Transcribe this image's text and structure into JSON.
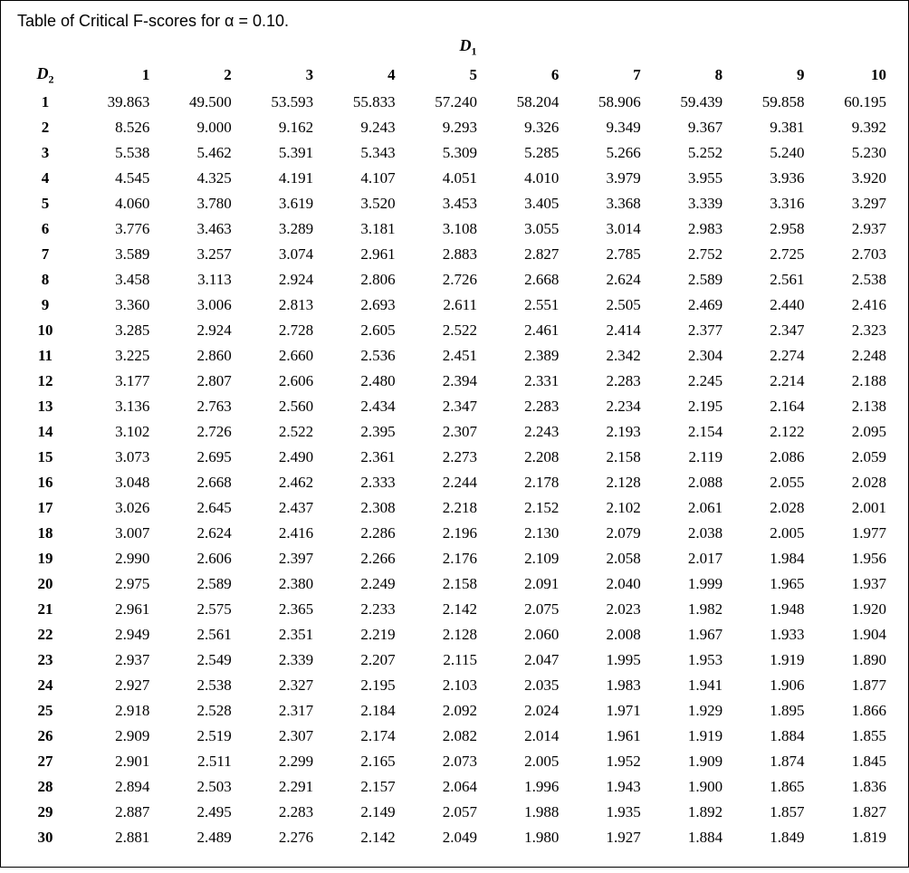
{
  "title": "Table of Critical F-scores for α = 0.10.",
  "d1_label": "D",
  "d1_sub": "1",
  "d2_label": "D",
  "d2_sub": "2",
  "chart_data": {
    "type": "table",
    "columns": [
      "1",
      "2",
      "3",
      "4",
      "5",
      "6",
      "7",
      "8",
      "9",
      "10"
    ],
    "rows": [
      {
        "d2": "1",
        "vals": [
          "39.863",
          "49.500",
          "53.593",
          "55.833",
          "57.240",
          "58.204",
          "58.906",
          "59.439",
          "59.858",
          "60.195"
        ]
      },
      {
        "d2": "2",
        "vals": [
          "8.526",
          "9.000",
          "9.162",
          "9.243",
          "9.293",
          "9.326",
          "9.349",
          "9.367",
          "9.381",
          "9.392"
        ]
      },
      {
        "d2": "3",
        "vals": [
          "5.538",
          "5.462",
          "5.391",
          "5.343",
          "5.309",
          "5.285",
          "5.266",
          "5.252",
          "5.240",
          "5.230"
        ]
      },
      {
        "d2": "4",
        "vals": [
          "4.545",
          "4.325",
          "4.191",
          "4.107",
          "4.051",
          "4.010",
          "3.979",
          "3.955",
          "3.936",
          "3.920"
        ]
      },
      {
        "d2": "5",
        "vals": [
          "4.060",
          "3.780",
          "3.619",
          "3.520",
          "3.453",
          "3.405",
          "3.368",
          "3.339",
          "3.316",
          "3.297"
        ]
      },
      {
        "d2": "6",
        "vals": [
          "3.776",
          "3.463",
          "3.289",
          "3.181",
          "3.108",
          "3.055",
          "3.014",
          "2.983",
          "2.958",
          "2.937"
        ]
      },
      {
        "d2": "7",
        "vals": [
          "3.589",
          "3.257",
          "3.074",
          "2.961",
          "2.883",
          "2.827",
          "2.785",
          "2.752",
          "2.725",
          "2.703"
        ]
      },
      {
        "d2": "8",
        "vals": [
          "3.458",
          "3.113",
          "2.924",
          "2.806",
          "2.726",
          "2.668",
          "2.624",
          "2.589",
          "2.561",
          "2.538"
        ]
      },
      {
        "d2": "9",
        "vals": [
          "3.360",
          "3.006",
          "2.813",
          "2.693",
          "2.611",
          "2.551",
          "2.505",
          "2.469",
          "2.440",
          "2.416"
        ]
      },
      {
        "d2": "10",
        "vals": [
          "3.285",
          "2.924",
          "2.728",
          "2.605",
          "2.522",
          "2.461",
          "2.414",
          "2.377",
          "2.347",
          "2.323"
        ]
      },
      {
        "d2": "11",
        "vals": [
          "3.225",
          "2.860",
          "2.660",
          "2.536",
          "2.451",
          "2.389",
          "2.342",
          "2.304",
          "2.274",
          "2.248"
        ]
      },
      {
        "d2": "12",
        "vals": [
          "3.177",
          "2.807",
          "2.606",
          "2.480",
          "2.394",
          "2.331",
          "2.283",
          "2.245",
          "2.214",
          "2.188"
        ]
      },
      {
        "d2": "13",
        "vals": [
          "3.136",
          "2.763",
          "2.560",
          "2.434",
          "2.347",
          "2.283",
          "2.234",
          "2.195",
          "2.164",
          "2.138"
        ]
      },
      {
        "d2": "14",
        "vals": [
          "3.102",
          "2.726",
          "2.522",
          "2.395",
          "2.307",
          "2.243",
          "2.193",
          "2.154",
          "2.122",
          "2.095"
        ]
      },
      {
        "d2": "15",
        "vals": [
          "3.073",
          "2.695",
          "2.490",
          "2.361",
          "2.273",
          "2.208",
          "2.158",
          "2.119",
          "2.086",
          "2.059"
        ]
      },
      {
        "d2": "16",
        "vals": [
          "3.048",
          "2.668",
          "2.462",
          "2.333",
          "2.244",
          "2.178",
          "2.128",
          "2.088",
          "2.055",
          "2.028"
        ]
      },
      {
        "d2": "17",
        "vals": [
          "3.026",
          "2.645",
          "2.437",
          "2.308",
          "2.218",
          "2.152",
          "2.102",
          "2.061",
          "2.028",
          "2.001"
        ]
      },
      {
        "d2": "18",
        "vals": [
          "3.007",
          "2.624",
          "2.416",
          "2.286",
          "2.196",
          "2.130",
          "2.079",
          "2.038",
          "2.005",
          "1.977"
        ]
      },
      {
        "d2": "19",
        "vals": [
          "2.990",
          "2.606",
          "2.397",
          "2.266",
          "2.176",
          "2.109",
          "2.058",
          "2.017",
          "1.984",
          "1.956"
        ]
      },
      {
        "d2": "20",
        "vals": [
          "2.975",
          "2.589",
          "2.380",
          "2.249",
          "2.158",
          "2.091",
          "2.040",
          "1.999",
          "1.965",
          "1.937"
        ]
      },
      {
        "d2": "21",
        "vals": [
          "2.961",
          "2.575",
          "2.365",
          "2.233",
          "2.142",
          "2.075",
          "2.023",
          "1.982",
          "1.948",
          "1.920"
        ]
      },
      {
        "d2": "22",
        "vals": [
          "2.949",
          "2.561",
          "2.351",
          "2.219",
          "2.128",
          "2.060",
          "2.008",
          "1.967",
          "1.933",
          "1.904"
        ]
      },
      {
        "d2": "23",
        "vals": [
          "2.937",
          "2.549",
          "2.339",
          "2.207",
          "2.115",
          "2.047",
          "1.995",
          "1.953",
          "1.919",
          "1.890"
        ]
      },
      {
        "d2": "24",
        "vals": [
          "2.927",
          "2.538",
          "2.327",
          "2.195",
          "2.103",
          "2.035",
          "1.983",
          "1.941",
          "1.906",
          "1.877"
        ]
      },
      {
        "d2": "25",
        "vals": [
          "2.918",
          "2.528",
          "2.317",
          "2.184",
          "2.092",
          "2.024",
          "1.971",
          "1.929",
          "1.895",
          "1.866"
        ]
      },
      {
        "d2": "26",
        "vals": [
          "2.909",
          "2.519",
          "2.307",
          "2.174",
          "2.082",
          "2.014",
          "1.961",
          "1.919",
          "1.884",
          "1.855"
        ]
      },
      {
        "d2": "27",
        "vals": [
          "2.901",
          "2.511",
          "2.299",
          "2.165",
          "2.073",
          "2.005",
          "1.952",
          "1.909",
          "1.874",
          "1.845"
        ]
      },
      {
        "d2": "28",
        "vals": [
          "2.894",
          "2.503",
          "2.291",
          "2.157",
          "2.064",
          "1.996",
          "1.943",
          "1.900",
          "1.865",
          "1.836"
        ]
      },
      {
        "d2": "29",
        "vals": [
          "2.887",
          "2.495",
          "2.283",
          "2.149",
          "2.057",
          "1.988",
          "1.935",
          "1.892",
          "1.857",
          "1.827"
        ]
      },
      {
        "d2": "30",
        "vals": [
          "2.881",
          "2.489",
          "2.276",
          "2.142",
          "2.049",
          "1.980",
          "1.927",
          "1.884",
          "1.849",
          "1.819"
        ]
      }
    ]
  }
}
